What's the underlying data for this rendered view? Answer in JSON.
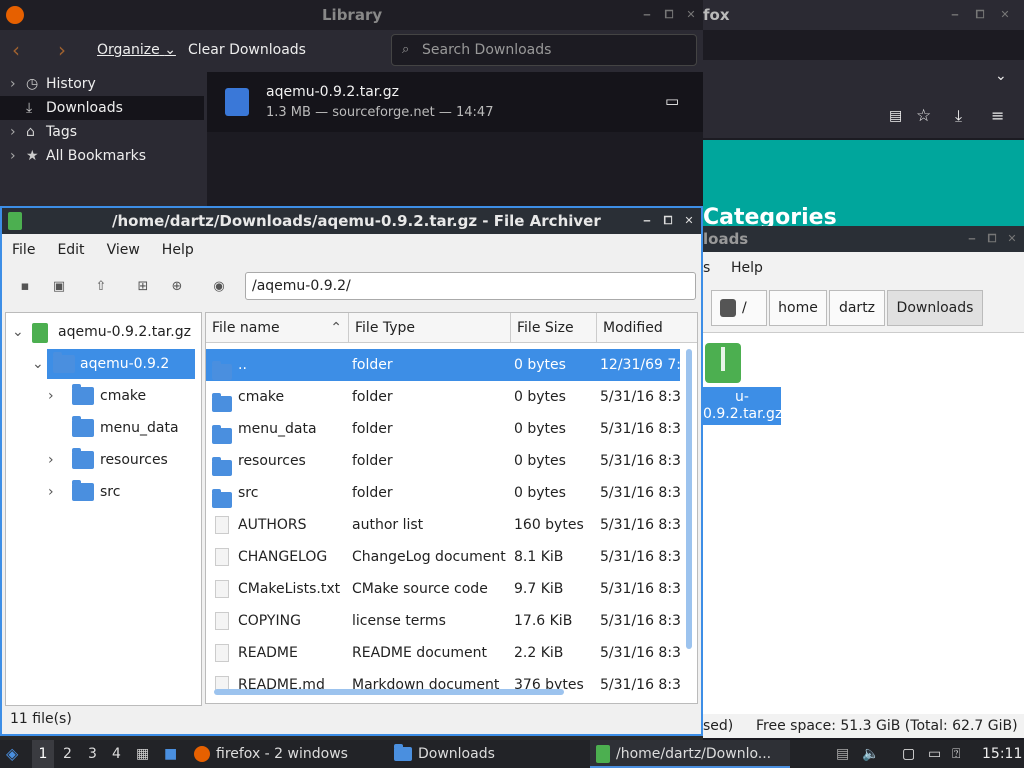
{
  "firefox": {
    "title": "fox",
    "heading": "Categories"
  },
  "library": {
    "title": "Library",
    "organize": "Organize",
    "clear": "Clear Downloads",
    "search_placeholder": "Search Downloads",
    "sidebar": [
      "History",
      "Downloads",
      "Tags",
      "All Bookmarks"
    ],
    "download": {
      "name": "aqemu-0.9.2.tar.gz",
      "meta": "1.3 MB — sourceforge.net — 14:47"
    }
  },
  "archiver": {
    "title": "/home/dartz/Downloads/aqemu-0.9.2.tar.gz - File Archiver",
    "menu": [
      "File",
      "Edit",
      "View",
      "Help"
    ],
    "path": "/aqemu-0.9.2/",
    "tree": [
      "aqemu-0.9.2.tar.gz",
      "aqemu-0.9.2",
      "cmake",
      "menu_data",
      "resources",
      "src"
    ],
    "columns": [
      "File name",
      "File Type",
      "File Size",
      "Modified"
    ],
    "rows": [
      {
        "name": "..",
        "type": "folder",
        "size": "0 bytes",
        "modified": "12/31/69 7:0"
      },
      {
        "name": "cmake",
        "type": "folder",
        "size": "0 bytes",
        "modified": "5/31/16 8:3"
      },
      {
        "name": "menu_data",
        "type": "folder",
        "size": "0 bytes",
        "modified": "5/31/16 8:3"
      },
      {
        "name": "resources",
        "type": "folder",
        "size": "0 bytes",
        "modified": "5/31/16 8:3"
      },
      {
        "name": "src",
        "type": "folder",
        "size": "0 bytes",
        "modified": "5/31/16 8:3"
      },
      {
        "name": "AUTHORS",
        "type": "author list",
        "size": "160 bytes",
        "modified": "5/31/16 8:3"
      },
      {
        "name": "CHANGELOG",
        "type": "ChangeLog document",
        "size": "8.1 KiB",
        "modified": "5/31/16 8:3"
      },
      {
        "name": "CMakeLists.txt",
        "type": "CMake source code",
        "size": "9.7 KiB",
        "modified": "5/31/16 8:3"
      },
      {
        "name": "COPYING",
        "type": "license terms",
        "size": "17.6 KiB",
        "modified": "5/31/16 8:3"
      },
      {
        "name": "README",
        "type": "README document",
        "size": "2.2 KiB",
        "modified": "5/31/16 8:3"
      },
      {
        "name": "README.md",
        "type": "Markdown document",
        "size": "376 bytes",
        "modified": "5/31/16 8:3"
      }
    ],
    "status": "11 file(s)"
  },
  "filemanager": {
    "menu_visible": [
      "s",
      "Help"
    ],
    "breadcrumb": [
      "/",
      "home",
      "dartz",
      "Downloads"
    ],
    "title_partial": "loads",
    "file_label": "u-0.9.2.tar.gz",
    "status_left": "sed)",
    "status_right": "Free space: 51.3 GiB (Total: 62.7 GiB)"
  },
  "taskbar": {
    "workspaces": [
      "1",
      "2",
      "3",
      "4"
    ],
    "tasks": [
      "firefox - 2 windows",
      "Downloads",
      "/home/dartz/Downlo..."
    ],
    "clock": "15:11"
  }
}
